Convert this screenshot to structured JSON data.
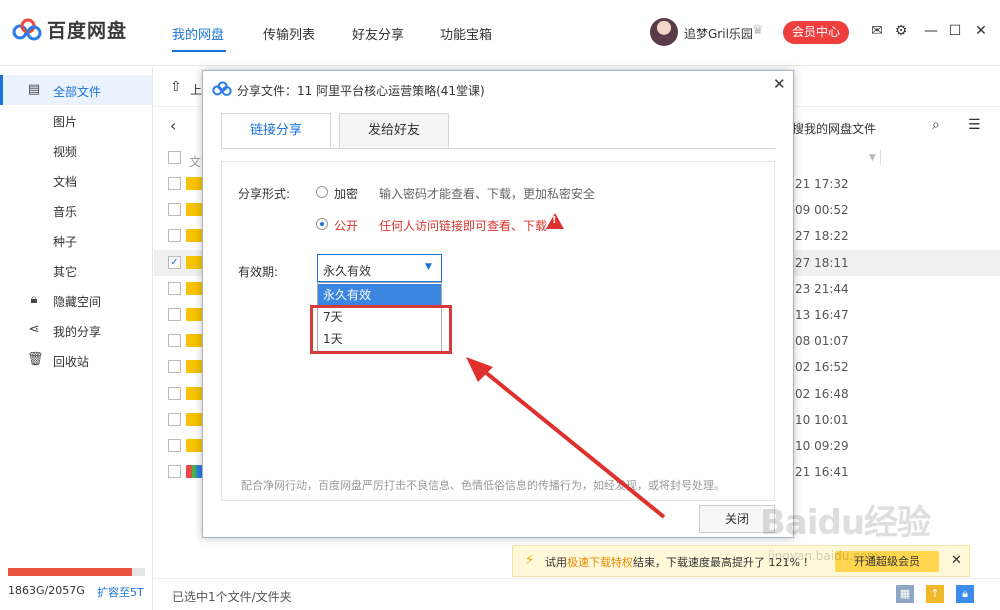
{
  "app": {
    "brand": "百度网盘"
  },
  "nav": {
    "tabs": [
      {
        "label": "我的网盘",
        "active": true
      },
      {
        "label": "传输列表"
      },
      {
        "label": "好友分享"
      },
      {
        "label": "功能宝箱"
      }
    ]
  },
  "user": {
    "name": "追梦Gril乐园",
    "vip_label": "会员中心"
  },
  "sidebar": {
    "items": [
      {
        "label": "全部文件",
        "icon": "file-icon",
        "active": true
      },
      {
        "label": "图片"
      },
      {
        "label": "视频"
      },
      {
        "label": "文档"
      },
      {
        "label": "音乐"
      },
      {
        "label": "种子"
      },
      {
        "label": "其它"
      },
      {
        "label": "隐藏空间",
        "icon": "lock-icon"
      },
      {
        "label": "我的分享",
        "icon": "share-icon"
      },
      {
        "label": "回收站",
        "icon": "trash-icon"
      }
    ],
    "storage": {
      "used": "1863G/2057G",
      "fraction": 0.906,
      "expand_label": "扩容至5T"
    }
  },
  "main": {
    "upload_label": "上",
    "search_hint": "搜我的网盘文件",
    "header_col": "文",
    "rows": [
      {
        "date": "21 17:32",
        "checked": false
      },
      {
        "date": "09 00:52",
        "checked": false
      },
      {
        "date": "27 18:22",
        "checked": false
      },
      {
        "date": "27 18:11",
        "checked": true
      },
      {
        "date": "23 21:44",
        "checked": false
      },
      {
        "date": "13 16:47",
        "checked": false
      },
      {
        "date": "08 01:07",
        "checked": false
      },
      {
        "date": "02 16:52",
        "checked": false
      },
      {
        "date": "02 16:48",
        "checked": false
      },
      {
        "date": "10 10:01",
        "checked": false
      },
      {
        "date": "10 09:29",
        "checked": false
      },
      {
        "date": "21 16:41",
        "checked": false
      }
    ],
    "status_text": "已选中1个文件/文件夹",
    "notice": {
      "prefix": "试用",
      "highlight": "极速下载特权",
      "suffix": "结束，下载速度最高提升了 121% !",
      "button": "开通超级会员"
    }
  },
  "dialog": {
    "title": "分享文件：11 阿里平台核心运营策略(41堂课)",
    "tabs": [
      {
        "label": "链接分享",
        "active": true
      },
      {
        "label": "发给好友"
      }
    ],
    "share_form_label": "分享形式:",
    "options": [
      {
        "label": "加密",
        "hint": "输入密码才能查看、下载，更加私密安全",
        "selected": false
      },
      {
        "label": "公开",
        "hint": "任何人访问链接即可查看、下载",
        "selected": true
      }
    ],
    "validity_label": "有效期:",
    "validity_value": "永久有效",
    "validity_options": [
      "永久有效",
      "7天",
      "1天"
    ],
    "footer_note": "配合净网行动，百度网盘严厉打击不良信息、色情低俗信息的传播行为，如经发现，或将封号处理。",
    "close_label": "关闭"
  },
  "watermark": {
    "main": "Baidu经验",
    "sub": "jingyan.baidu.com"
  },
  "colors": {
    "accent": "#1a73d9",
    "vip": "#ef3e3e",
    "warning": "#d8352e",
    "folder": "#f7c200"
  }
}
